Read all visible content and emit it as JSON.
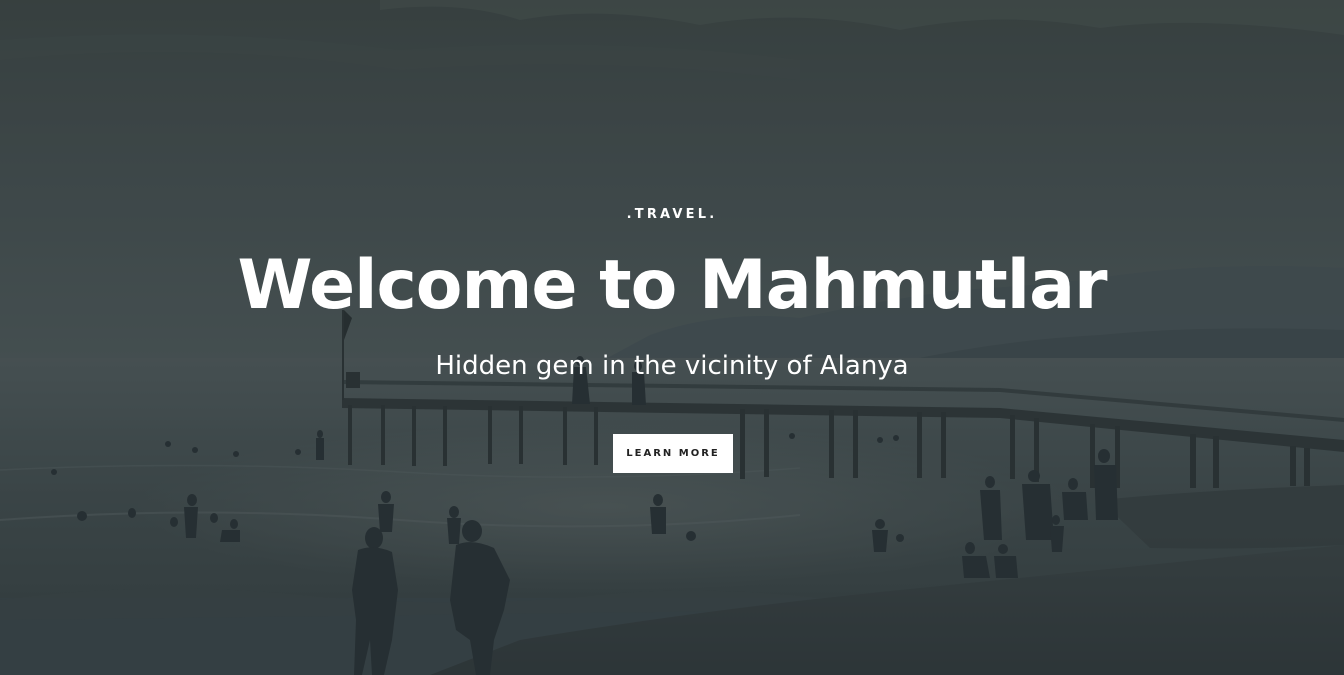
{
  "hero": {
    "eyebrow": ".TRAVEL.",
    "title": "Welcome to Mahmutlar",
    "subtitle": "Hidden gem in the vicinity of Alanya",
    "cta_label": "LEARN MORE",
    "background_image": "beach-pier-sunset-photo"
  },
  "colors": {
    "overlay": "#2f3a3d",
    "text": "#ffffff",
    "button_bg": "#ffffff",
    "button_text": "#222222"
  }
}
